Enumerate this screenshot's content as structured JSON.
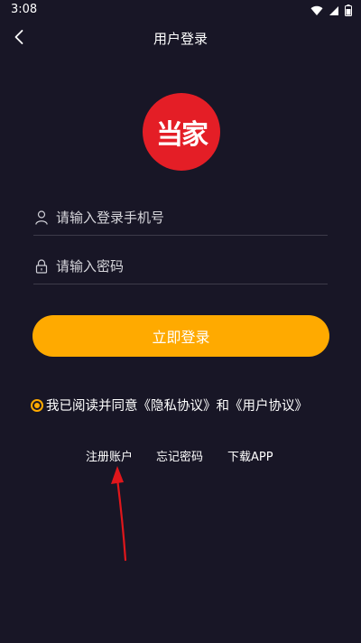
{
  "status_bar": {
    "time": "3:08",
    "icons": [
      "wifi-icon",
      "signal-icon",
      "battery-icon"
    ]
  },
  "nav": {
    "title": "用户登录",
    "back_icon": "chevron-left-icon"
  },
  "logo": {
    "text": "当家",
    "color": "#e41e26"
  },
  "form": {
    "phone_placeholder": "请输入登录手机号",
    "phone_value": "",
    "password_placeholder": "请输入密码",
    "password_value": "",
    "login_label": "立即登录"
  },
  "agreement": {
    "checked": true,
    "prefix": "我已阅读并同意",
    "privacy_link": "《隐私协议》",
    "conjunction": "和",
    "user_link": "《用户协议》"
  },
  "links": {
    "register": "注册账户",
    "forgot": "忘记密码",
    "download": "下载APP"
  },
  "colors": {
    "background": "#181626",
    "accent": "#ffaa00",
    "annotation": "#e0161b"
  }
}
